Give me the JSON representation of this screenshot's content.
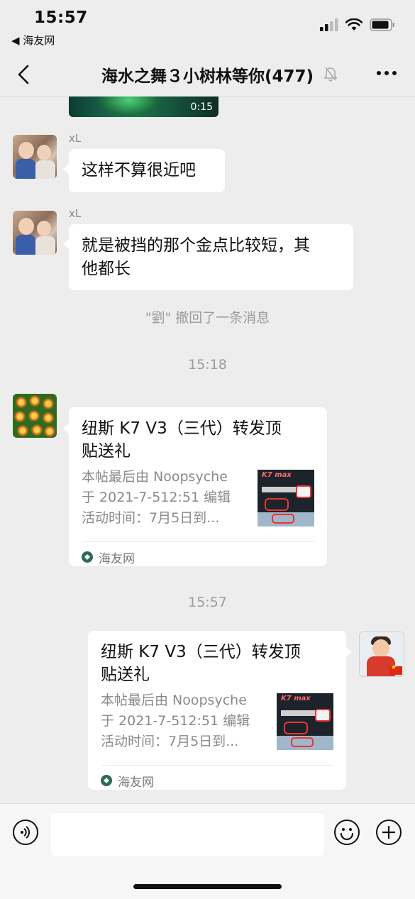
{
  "status_bar": {
    "time": "15:57",
    "back_app": "◀ 海友网"
  },
  "nav": {
    "title": "海水之舞３小树林等你(477)",
    "muted": true
  },
  "video": {
    "duration": "0:15"
  },
  "messages": [
    {
      "sender": "xL",
      "text": "这样不算很近吧"
    },
    {
      "sender": "xL",
      "text_lines": [
        "就是被挡的那个金点比较短，其",
        "他都长"
      ]
    }
  ],
  "system": {
    "recall": "\"劉\" 撤回了一条消息",
    "time1": "15:18",
    "time2": "15:57"
  },
  "cards": [
    {
      "title_lines": [
        "纽斯 K7 V3（三代）转发顶",
        "贴送礼"
      ],
      "desc_lines": [
        "本帖最后由 Noopsyche",
        "于 2021-7-512:51 编辑",
        "活动时间：7月5日到..."
      ],
      "source": "海友网"
    },
    {
      "title_lines": [
        "纽斯 K7 V3（三代）转发顶",
        "贴送礼"
      ],
      "desc_lines": [
        "本帖最后由 Noopsyche",
        "于 2021-7-512:51 编辑",
        "活动时间：7月5日到..."
      ],
      "source": "海友网"
    }
  ],
  "thumb_text": "K7 max",
  "icons": {
    "voice": "voice-icon",
    "emoji": "emoji-icon",
    "plus": "plus-icon"
  },
  "colors": {
    "background": "#ededed",
    "bubble": "#ffffff",
    "meta_text": "#9c9c9c"
  }
}
